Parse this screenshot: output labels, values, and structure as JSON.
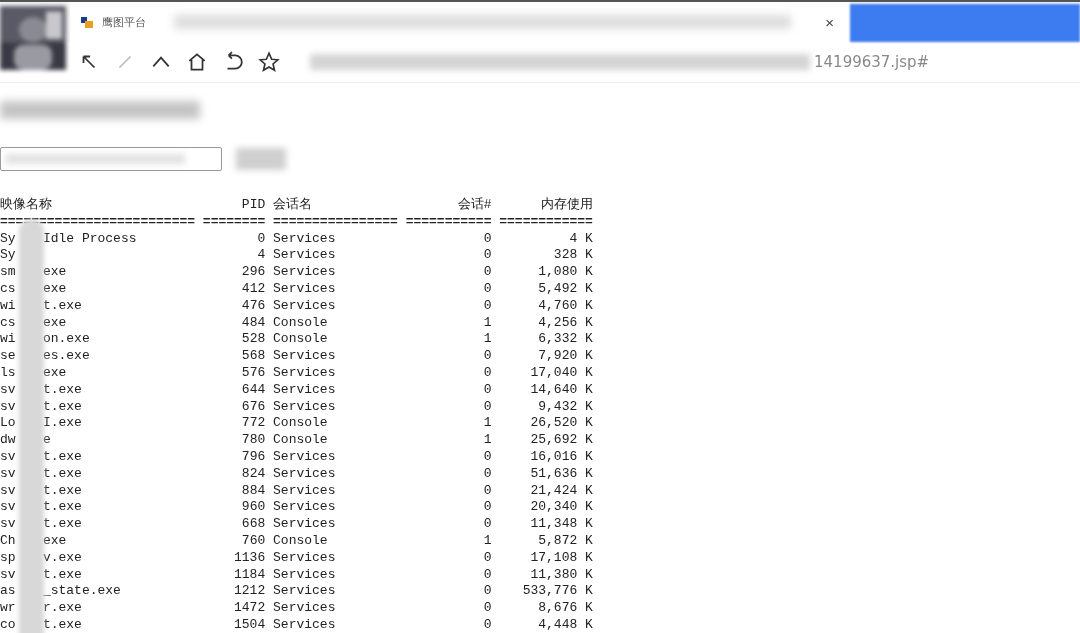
{
  "browser": {
    "tab": {
      "title": "鹰图平台",
      "close": "×",
      "selected": true
    },
    "nav": [
      {
        "kind": "back",
        "disabled": false
      },
      {
        "kind": "forward",
        "disabled": true
      },
      {
        "kind": "up",
        "disabled": false
      },
      {
        "kind": "home",
        "disabled": false
      },
      {
        "kind": "undo",
        "disabled": false
      },
      {
        "kind": "star",
        "disabled": false
      }
    ],
    "address": {
      "url_end": "14199637.jsp#"
    }
  },
  "task_list": {
    "columns": [
      "映像名称",
      "PID",
      "会话名",
      "会话#",
      "内存使用"
    ],
    "separators": [
      "=========================",
      "========",
      "================",
      "===========",
      "============"
    ],
    "rows": [
      {
        "name_start": "Sy",
        "name_end": "Idle Process",
        "pid": "0",
        "session": "Services",
        "session_no": "0",
        "memory": "4 K"
      },
      {
        "name_start": "Sy",
        "pid": "4",
        "session": "Services",
        "session_no": "0",
        "memory": "328 K"
      },
      {
        "name_start": "sm",
        "name_end": "exe",
        "pid": "296",
        "session": "Services",
        "session_no": "0",
        "memory": "1,080 K"
      },
      {
        "name_start": "cs",
        "name_end": "exe",
        "pid": "412",
        "session": "Services",
        "session_no": "0",
        "memory": "5,492 K"
      },
      {
        "name_start": "wi",
        "name_end": "t.exe",
        "pid": "476",
        "session": "Services",
        "session_no": "0",
        "memory": "4,760 K"
      },
      {
        "name_start": "cs",
        "name_end": "exe",
        "pid": "484",
        "session": "Console",
        "session_no": "1",
        "memory": "4,256 K"
      },
      {
        "name_start": "wi",
        "name_end": "on.exe",
        "pid": "528",
        "session": "Console",
        "session_no": "1",
        "memory": "6,332 K"
      },
      {
        "name_start": "se",
        "name_end": "es.exe",
        "pid": "568",
        "session": "Services",
        "session_no": "0",
        "memory": "7,920 K"
      },
      {
        "name_start": "ls",
        "name_end": "exe",
        "pid": "576",
        "session": "Services",
        "session_no": "0",
        "memory": "17,040 K"
      },
      {
        "name_start": "sv",
        "name_end": "t.exe",
        "pid": "644",
        "session": "Services",
        "session_no": "0",
        "memory": "14,640 K"
      },
      {
        "name_start": "sv",
        "name_end": "t.exe",
        "pid": "676",
        "session": "Services",
        "session_no": "0",
        "memory": "9,432 K"
      },
      {
        "name_start": "Lo",
        "name_end": "I.exe",
        "pid": "772",
        "session": "Console",
        "session_no": "1",
        "memory": "26,520 K"
      },
      {
        "name_start": "dw",
        "name_end": "e",
        "pid": "780",
        "session": "Console",
        "session_no": "1",
        "memory": "25,692 K"
      },
      {
        "name_start": "sv",
        "name_end": "t.exe",
        "pid": "796",
        "session": "Services",
        "session_no": "0",
        "memory": "16,016 K"
      },
      {
        "name_start": "sv",
        "name_end": "t.exe",
        "pid": "824",
        "session": "Services",
        "session_no": "0",
        "memory": "51,636 K"
      },
      {
        "name_start": "sv",
        "name_end": "t.exe",
        "pid": "884",
        "session": "Services",
        "session_no": "0",
        "memory": "21,424 K"
      },
      {
        "name_start": "sv",
        "name_end": "t.exe",
        "pid": "960",
        "session": "Services",
        "session_no": "0",
        "memory": "20,340 K"
      },
      {
        "name_start": "sv",
        "name_end": "t.exe",
        "pid": "668",
        "session": "Services",
        "session_no": "0",
        "memory": "11,348 K"
      },
      {
        "name_start": "Ch",
        "name_end": "exe",
        "pid": "760",
        "session": "Console",
        "session_no": "1",
        "memory": "5,872 K"
      },
      {
        "name_start": "sp",
        "name_end": "v.exe",
        "pid": "1136",
        "session": "Services",
        "session_no": "0",
        "memory": "17,108 K"
      },
      {
        "name_start": "sv",
        "name_end": "t.exe",
        "pid": "1184",
        "session": "Services",
        "session_no": "0",
        "memory": "11,380 K"
      },
      {
        "name_start": "as",
        "name_end": "_state.exe",
        "pid": "1212",
        "session": "Services",
        "session_no": "0",
        "memory": "533,776 K"
      },
      {
        "name_start": "wr",
        "name_end": "r.exe",
        "pid": "1472",
        "session": "Services",
        "session_no": "0",
        "memory": "8,676 K"
      },
      {
        "name_start": "co",
        "name_end": "t.exe",
        "pid": "1504",
        "session": "Services",
        "session_no": "0",
        "memory": "4,448 K"
      }
    ]
  }
}
